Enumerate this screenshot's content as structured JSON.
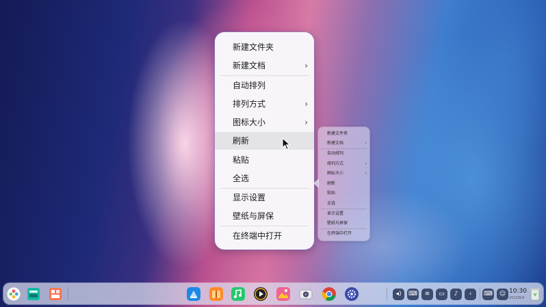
{
  "context_menu": {
    "items": [
      {
        "label": "新建文件夹",
        "has_submenu": false,
        "highlighted": false
      },
      {
        "label": "新建文档",
        "has_submenu": true,
        "highlighted": false
      },
      {
        "label": "自动排列",
        "has_submenu": false,
        "highlighted": false
      },
      {
        "label": "排列方式",
        "has_submenu": true,
        "highlighted": false
      },
      {
        "label": "图标大小",
        "has_submenu": true,
        "highlighted": false
      },
      {
        "label": "刷新",
        "has_submenu": false,
        "highlighted": true
      },
      {
        "label": "粘贴",
        "has_submenu": false,
        "highlighted": false
      },
      {
        "label": "全选",
        "has_submenu": false,
        "highlighted": false
      },
      {
        "label": "显示设置",
        "has_submenu": false,
        "highlighted": false
      },
      {
        "label": "壁纸与屏保",
        "has_submenu": false,
        "highlighted": false
      },
      {
        "label": "在终端中打开",
        "has_submenu": false,
        "highlighted": false
      }
    ],
    "submenu_arrow": "›"
  },
  "preview_menu": {
    "items": [
      "新建文件夹",
      "新建文档",
      "自动排列",
      "排列方式",
      "图标大小",
      "刷新",
      "粘贴",
      "全选",
      "显示设置",
      "壁纸与屏保",
      "在终端中打开"
    ]
  },
  "taskbar": {
    "left_icons": [
      "launcher-icon",
      "multitask-view-icon",
      "workspace-icon"
    ],
    "center_apps": [
      "app-store-icon",
      "archive-manager-icon",
      "music-icon",
      "video-player-icon",
      "image-viewer-icon",
      "camera-icon",
      "chrome-icon",
      "system-settings-icon"
    ],
    "tray_icons": [
      "volume-icon",
      "keyboard-icon",
      "wifi-icon",
      "battery-icon",
      "notification-icon",
      "chevron-left-icon",
      "onscreen-keyboard-icon",
      "assistant-icon"
    ],
    "clock": {
      "time": "10:30",
      "date": "2023/8/4"
    },
    "trash": "trash-icon"
  },
  "colors": {
    "menu_bg": "#f8f8fc",
    "highlight": "#e4e4e8",
    "taskbar_bg": "#dee0f0"
  }
}
